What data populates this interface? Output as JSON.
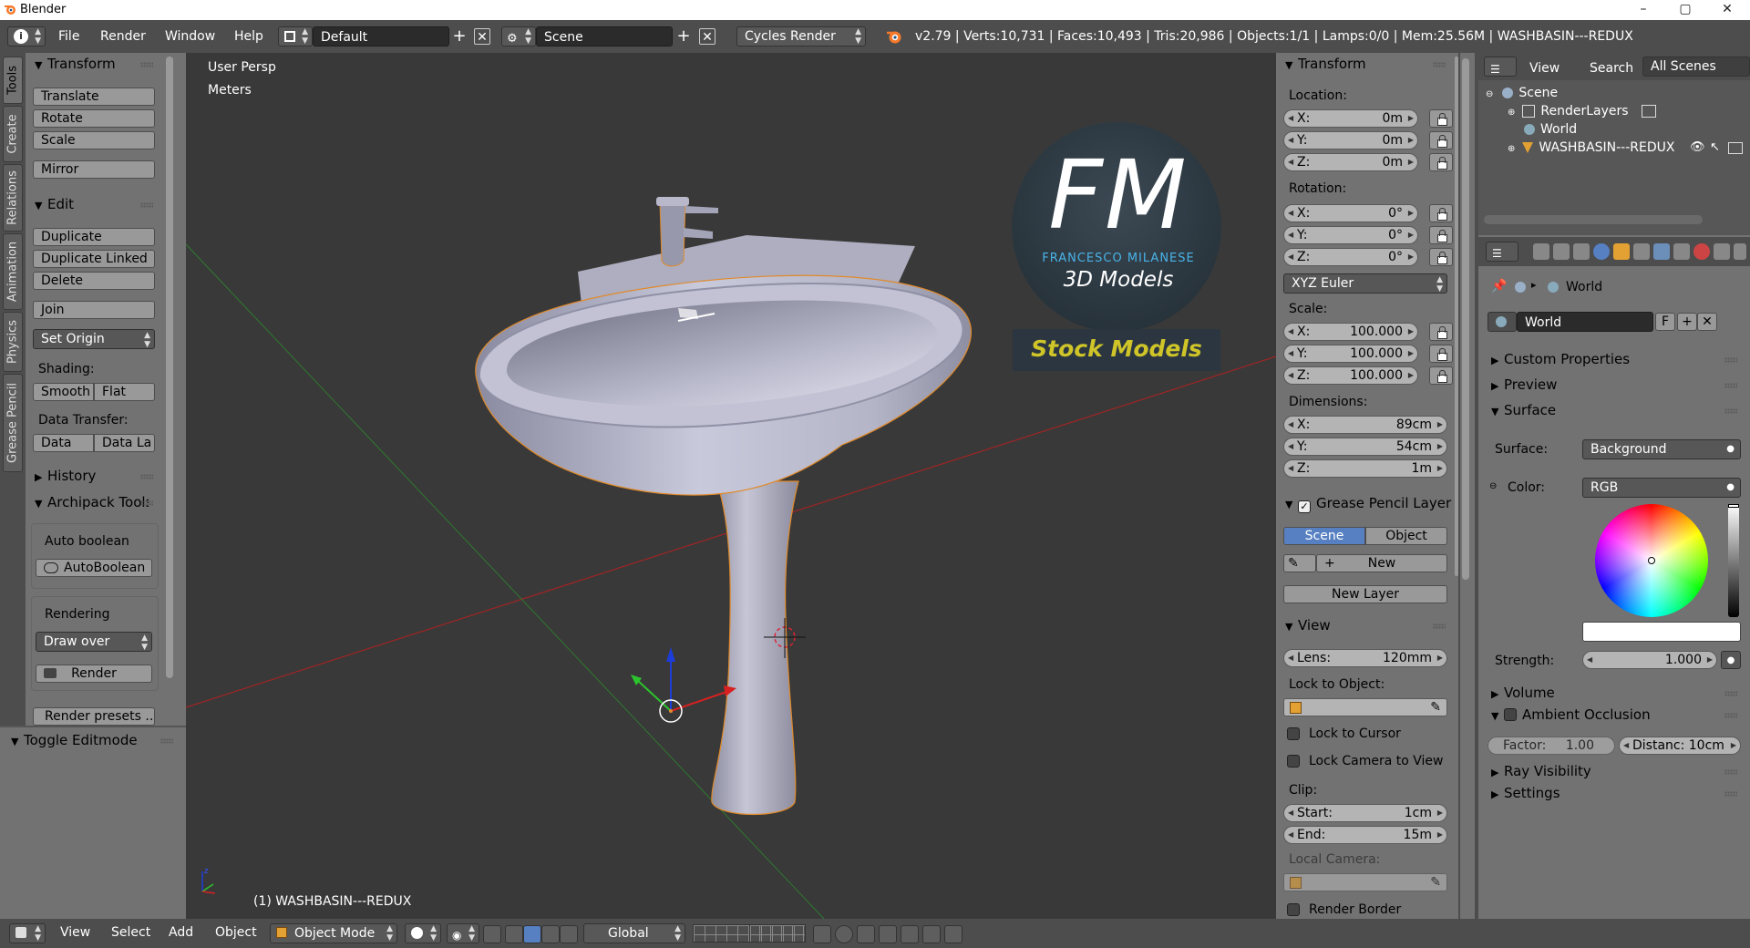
{
  "window": {
    "title": "Blender",
    "controls": {
      "minimize": "–",
      "maximize": "▢",
      "close": "✕"
    }
  },
  "header": {
    "menus": [
      "File",
      "Render",
      "Window",
      "Help"
    ],
    "layout": "Default",
    "scene": "Scene",
    "engine": "Cycles Render",
    "stats": "v2.79 | Verts:10,731 | Faces:10,493 | Tris:20,986 | Objects:1/1 | Lamps:0/0 | Mem:25.56M | WASHBASIN---REDUX"
  },
  "tools_tabs": [
    "Tools",
    "Create",
    "Relations",
    "Animation",
    "Physics",
    "Grease Pencil"
  ],
  "toolshelf": {
    "transform": {
      "title": "Transform",
      "buttons": [
        "Translate",
        "Rotate",
        "Scale",
        "Mirror"
      ]
    },
    "edit": {
      "title": "Edit",
      "buttons": [
        "Duplicate",
        "Duplicate Linked",
        "Delete",
        "Join"
      ],
      "set_origin": "Set Origin",
      "shading_label": "Shading:",
      "smooth": "Smooth",
      "flat": "Flat",
      "data_transfer_label": "Data Transfer:",
      "data": "Data",
      "data_layout": "Data La"
    },
    "history": {
      "title": "History"
    },
    "archipack": {
      "title": "Archipack Tools",
      "auto_boolean_label": "Auto boolean",
      "auto_boolean_btn": "AutoBoolean",
      "rendering_label": "Rendering",
      "draw_mode": "Draw over",
      "render_btn": "Render",
      "render_presets": "Render presets ..."
    },
    "operator": {
      "title": "Toggle Editmode"
    }
  },
  "viewport": {
    "view_name": "User Persp",
    "units": "Meters",
    "object_label": "(1) WASHBASIN---REDUX",
    "watermark": {
      "logo_letters": "FM",
      "author": "FRANCESCO MILANESE",
      "subtitle": "3D Models",
      "banner": "Stock Models"
    }
  },
  "properties_n": {
    "transform_title": "Transform",
    "location_label": "Location:",
    "location": [
      {
        "k": "X:",
        "v": "0m"
      },
      {
        "k": "Y:",
        "v": "0m"
      },
      {
        "k": "Z:",
        "v": "0m"
      }
    ],
    "rotation_label": "Rotation:",
    "rotation": [
      {
        "k": "X:",
        "v": "0°"
      },
      {
        "k": "Y:",
        "v": "0°"
      },
      {
        "k": "Z:",
        "v": "0°"
      }
    ],
    "rotation_mode": "XYZ Euler",
    "scale_label": "Scale:",
    "scale": [
      {
        "k": "X:",
        "v": "100.000"
      },
      {
        "k": "Y:",
        "v": "100.000"
      },
      {
        "k": "Z:",
        "v": "100.000"
      }
    ],
    "dimensions_label": "Dimensions:",
    "dimensions": [
      {
        "k": "X:",
        "v": "89cm"
      },
      {
        "k": "Y:",
        "v": "54cm"
      },
      {
        "k": "Z:",
        "v": "1m"
      }
    ],
    "gp_title": "Grease Pencil Layer",
    "gp_scene": "Scene",
    "gp_object": "Object",
    "gp_new": "New",
    "gp_new_layer": "New Layer",
    "view_title": "View",
    "lens_key": "Lens:",
    "lens_val": "120mm",
    "lock_to_object": "Lock to Object:",
    "lock_cursor": "Lock to Cursor",
    "lock_camera": "Lock Camera to View",
    "clip_label": "Clip:",
    "clip_start_key": "Start:",
    "clip_start_val": "1cm",
    "clip_end_key": "End:",
    "clip_end_val": "15m",
    "local_camera": "Local Camera:",
    "render_border": "Render Border"
  },
  "outliner": {
    "view": "View",
    "search": "Search",
    "filter": "All Scenes",
    "items": [
      "Scene",
      "RenderLayers",
      "World",
      "WASHBASIN---REDUX"
    ]
  },
  "world_props": {
    "breadcrumb": "World",
    "world_name": "World",
    "fake_user": "F",
    "panels": {
      "custom": "Custom Properties",
      "preview": "Preview",
      "surface": "Surface",
      "volume": "Volume",
      "ao": "Ambient Occlusion",
      "ray": "Ray Visibility",
      "settings": "Settings"
    },
    "surface_label": "Surface:",
    "surface_value": "Background",
    "color_label": "Color:",
    "color_mode": "RGB",
    "strength_key": "Strength:",
    "strength_val": "1.000",
    "factor_key": "Factor:",
    "factor_val": "1.00",
    "distance": "Distanc: 10cm"
  },
  "bottombar": {
    "menus": [
      "View",
      "Select",
      "Add",
      "Object"
    ],
    "mode": "Object Mode",
    "orientation": "Global"
  },
  "colors": {
    "accent": "#5680c2",
    "viewport_bg": "#393939",
    "panel_bg": "#727272",
    "header_bg": "#4d4d4d",
    "selection": "#f08a24"
  }
}
